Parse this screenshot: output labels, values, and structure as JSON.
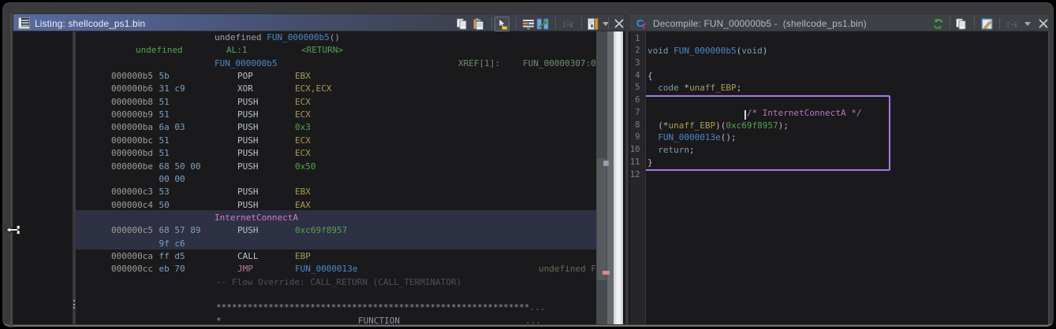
{
  "window": {
    "name": "ghidra-codebrowser"
  },
  "listing_panel": {
    "title": "Listing: shellcode_ps1.bin",
    "icon": "listing-icon",
    "toolbar": [
      {
        "icon": "copy-icon"
      },
      {
        "icon": "paste-icon"
      },
      {
        "sep": true
      },
      {
        "icon": "hover-popups-icon",
        "pressed": true
      },
      {
        "sep": true
      },
      {
        "icon": "edit-fields-icon"
      },
      {
        "icon": "diff-view-icon"
      },
      {
        "sep": true
      },
      {
        "icon": "snapshot-icon"
      },
      {
        "sep": true
      },
      {
        "icon": "margin-icon"
      },
      {
        "icon": "dropdown-icon"
      },
      {
        "sep": true
      },
      {
        "icon": "close-icon"
      }
    ],
    "rows": [
      {
        "name": "function-signature-row",
        "cells": [
          {
            "col": "label",
            "seg": [
              {
                "c": "sig",
                "s": "undefined "
              },
              {
                "c": "fn",
                "s": "FUN_000000b5"
              },
              {
                "c": "sig",
                "s": "()"
              }
            ]
          }
        ]
      },
      {
        "name": "register-row",
        "cells": [
          {
            "col": "ret_type",
            "c": "green",
            "s": "undefined"
          },
          {
            "col": "reg_loc",
            "c": "green",
            "s": "AL:1"
          },
          {
            "col": "ret_tag",
            "c": "green",
            "s": "<RETURN>"
          }
        ]
      },
      {
        "name": "function-label-row",
        "cells": [
          {
            "col": "label",
            "c": "fn",
            "s": "FUN_000000b5"
          },
          {
            "col": "xref",
            "c": "xref",
            "s": "XREF[1]:"
          },
          {
            "col": "xref_target",
            "c": "xref",
            "s": "FUN_00000307:0"
          }
        ]
      },
      {
        "name": "instruction-row",
        "cells": [
          {
            "col": "addr",
            "c": "addr",
            "s": "000000b5"
          },
          {
            "col": "bytes",
            "c": "byte",
            "s": "5b"
          },
          {
            "col": "mnemonic",
            "c": "mnem",
            "s": "POP"
          },
          {
            "col": "operand",
            "c": "reg",
            "s": "EBX"
          }
        ]
      },
      {
        "name": "instruction-row",
        "cells": [
          {
            "col": "addr",
            "c": "addr",
            "s": "000000b6"
          },
          {
            "col": "bytes",
            "c": "byte",
            "s": "31 c9"
          },
          {
            "col": "mnemonic",
            "c": "mnem",
            "s": "XOR"
          },
          {
            "col": "operand",
            "c": "reg",
            "s": "ECX,ECX"
          }
        ]
      },
      {
        "name": "instruction-row",
        "cells": [
          {
            "col": "addr",
            "c": "addr",
            "s": "000000b8"
          },
          {
            "col": "bytes",
            "c": "byte",
            "s": "51"
          },
          {
            "col": "mnemonic",
            "c": "mnem",
            "s": "PUSH"
          },
          {
            "col": "operand",
            "c": "reg",
            "s": "ECX"
          }
        ]
      },
      {
        "name": "instruction-row",
        "cells": [
          {
            "col": "addr",
            "c": "addr",
            "s": "000000b9"
          },
          {
            "col": "bytes",
            "c": "byte",
            "s": "51"
          },
          {
            "col": "mnemonic",
            "c": "mnem",
            "s": "PUSH"
          },
          {
            "col": "operand",
            "c": "reg",
            "s": "ECX"
          }
        ]
      },
      {
        "name": "instruction-row",
        "cells": [
          {
            "col": "addr",
            "c": "addr",
            "s": "000000ba"
          },
          {
            "col": "bytes",
            "c": "byte",
            "s": "6a 03"
          },
          {
            "col": "mnemonic",
            "c": "mnem",
            "s": "PUSH"
          },
          {
            "col": "operand",
            "c": "scalar",
            "s": "0x3"
          }
        ]
      },
      {
        "name": "instruction-row",
        "cells": [
          {
            "col": "addr",
            "c": "addr",
            "s": "000000bc"
          },
          {
            "col": "bytes",
            "c": "byte",
            "s": "51"
          },
          {
            "col": "mnemonic",
            "c": "mnem",
            "s": "PUSH"
          },
          {
            "col": "operand",
            "c": "reg",
            "s": "ECX"
          }
        ]
      },
      {
        "name": "instruction-row",
        "cells": [
          {
            "col": "addr",
            "c": "addr",
            "s": "000000bd"
          },
          {
            "col": "bytes",
            "c": "byte",
            "s": "51"
          },
          {
            "col": "mnemonic",
            "c": "mnem",
            "s": "PUSH"
          },
          {
            "col": "operand",
            "c": "reg",
            "s": "ECX"
          }
        ]
      },
      {
        "name": "instruction-row",
        "cells": [
          {
            "col": "addr",
            "c": "addr",
            "s": "000000be"
          },
          {
            "col": "bytes",
            "c": "byte",
            "s": "68 50 00"
          },
          {
            "col": "mnemonic",
            "c": "mnem",
            "s": "PUSH"
          },
          {
            "col": "operand",
            "c": "scalar",
            "s": "0x50"
          }
        ]
      },
      {
        "name": "bytes-continuation-row",
        "cells": [
          {
            "col": "bytes",
            "c": "byte",
            "s": "00 00"
          }
        ]
      },
      {
        "name": "instruction-row",
        "cells": [
          {
            "col": "addr",
            "c": "addr",
            "s": "000000c3"
          },
          {
            "col": "bytes",
            "c": "byte",
            "s": "53"
          },
          {
            "col": "mnemonic",
            "c": "mnem",
            "s": "PUSH"
          },
          {
            "col": "operand",
            "c": "reg",
            "s": "EBX"
          }
        ]
      },
      {
        "name": "instruction-row",
        "cells": [
          {
            "col": "addr",
            "c": "addr",
            "s": "000000c4"
          },
          {
            "col": "bytes",
            "c": "byte",
            "s": "50"
          },
          {
            "col": "mnemonic",
            "c": "mnem",
            "s": "PUSH"
          },
          {
            "col": "operand",
            "c": "reg",
            "s": "EAX"
          }
        ]
      },
      {
        "name": "label-row",
        "highlight": true,
        "cells": [
          {
            "col": "label",
            "c": "pink",
            "s": "InternetConnectA"
          }
        ]
      },
      {
        "name": "instruction-row",
        "highlight": true,
        "cells": [
          {
            "col": "addr",
            "c": "addr",
            "s": "000000c5"
          },
          {
            "col": "bytes",
            "c": "byte",
            "s": "68 57 89"
          },
          {
            "col": "mnemonic",
            "c": "mnem",
            "s": "PUSH"
          },
          {
            "col": "operand",
            "c": "scalar",
            "s": "0xc69f8957"
          }
        ]
      },
      {
        "name": "bytes-continuation-row",
        "highlight": true,
        "cells": [
          {
            "col": "bytes",
            "c": "byte",
            "s": "9f c6"
          }
        ]
      },
      {
        "name": "instruction-row",
        "cells": [
          {
            "col": "addr",
            "c": "addr",
            "s": "000000ca"
          },
          {
            "col": "bytes",
            "c": "byte",
            "s": "ff d5"
          },
          {
            "col": "mnemonic",
            "c": "mnem",
            "s": "CALL"
          },
          {
            "col": "operand",
            "c": "reg",
            "s": "EBP"
          }
        ]
      },
      {
        "name": "instruction-row",
        "cells": [
          {
            "col": "addr",
            "c": "addr",
            "s": "000000cc"
          },
          {
            "col": "bytes",
            "c": "byte",
            "s": "eb 70"
          },
          {
            "col": "mnemonic",
            "c": "jmp",
            "s": "JMP"
          },
          {
            "col": "operand",
            "c": "fn",
            "s": "FUN_0000013e"
          },
          {
            "col": "right",
            "c": "dimright",
            "s": "undefined F"
          }
        ]
      },
      {
        "name": "flow-override-row",
        "cells": [
          {
            "col": "comment",
            "c": "dimcmt",
            "s": "-- Flow Override: CALL_RETURN (CALL_TERMINATOR)"
          }
        ]
      },
      {
        "name": "empty-row",
        "cells": []
      },
      {
        "name": "plate-comment-row",
        "cells": [
          {
            "col": "comment",
            "seg": [
              {
                "c": "plate",
                "s": "************************************************************"
              },
              {
                "c": "platedim",
                "s": "..."
              }
            ]
          }
        ]
      },
      {
        "name": "plate-comment-row",
        "cells": [
          {
            "col": "comment",
            "c": "plate",
            "s": "*"
          },
          {
            "col": "plate_fn",
            "c": "plate",
            "s": "FUNCTION"
          },
          {
            "col": "plate_dots",
            "c": "platedim",
            "s": "..."
          }
        ]
      }
    ],
    "highlight_color": "#2e3043",
    "scrollbar": {
      "thumb": true
    },
    "overview_markers": [
      "cursor-marker",
      "red-marker"
    ]
  },
  "decompile_panel": {
    "title": "Decompile: FUN_000000b5 -  (shellcode_ps1.bin)",
    "icon": "decompiler-icon",
    "toolbar": [
      {
        "icon": "refresh-icon"
      },
      {
        "sep": true
      },
      {
        "icon": "copy-icon"
      },
      {
        "sep": true
      },
      {
        "icon": "edit-icon"
      },
      {
        "sep": true
      },
      {
        "icon": "snapshot-icon"
      },
      {
        "icon": "dropdown-icon"
      },
      {
        "icon": "close-icon"
      }
    ],
    "scope_box_color": "#a478da",
    "lines": [
      {
        "num": "1",
        "seg": []
      },
      {
        "num": "2",
        "seg": [
          {
            "c": "type",
            "s": "void "
          },
          {
            "c": "fn",
            "s": "FUN_000000b5"
          },
          {
            "c": "punc",
            "s": "("
          },
          {
            "c": "type",
            "s": "void"
          },
          {
            "c": "punc",
            "s": ")"
          }
        ]
      },
      {
        "num": "3",
        "seg": []
      },
      {
        "num": "4",
        "seg": [
          {
            "c": "punc",
            "s": "{"
          }
        ]
      },
      {
        "num": "5",
        "seg": [
          {
            "c": "punc",
            "s": "  "
          },
          {
            "c": "type",
            "s": "code"
          },
          {
            "c": "punc",
            "s": " *"
          },
          {
            "c": "var",
            "s": "unaff_EBP"
          },
          {
            "c": "punc",
            "s": ";"
          }
        ]
      },
      {
        "num": "6",
        "seg": []
      },
      {
        "num": "7",
        "seg": [
          {
            "c": "punc",
            "s": "                   "
          },
          {
            "c": "cmt",
            "s": "/* InternetConnectA */"
          }
        ]
      },
      {
        "num": "8",
        "seg": [
          {
            "c": "punc",
            "s": "  (*"
          },
          {
            "c": "var",
            "s": "unaff_EBP"
          },
          {
            "c": "punc",
            "s": ")("
          },
          {
            "c": "scalar",
            "s": "0xc69f8957"
          },
          {
            "c": "punc",
            "s": ");"
          }
        ]
      },
      {
        "num": "9",
        "seg": [
          {
            "c": "punc",
            "s": "  "
          },
          {
            "c": "fn",
            "s": "FUN_0000013e"
          },
          {
            "c": "punc",
            "s": "();"
          }
        ]
      },
      {
        "num": "10",
        "seg": [
          {
            "c": "punc",
            "s": "  "
          },
          {
            "c": "kw",
            "s": "return"
          },
          {
            "c": "punc",
            "s": ";"
          }
        ]
      },
      {
        "num": "11",
        "seg": [
          {
            "c": "punc",
            "s": "}"
          }
        ]
      },
      {
        "num": "12",
        "seg": []
      }
    ]
  }
}
